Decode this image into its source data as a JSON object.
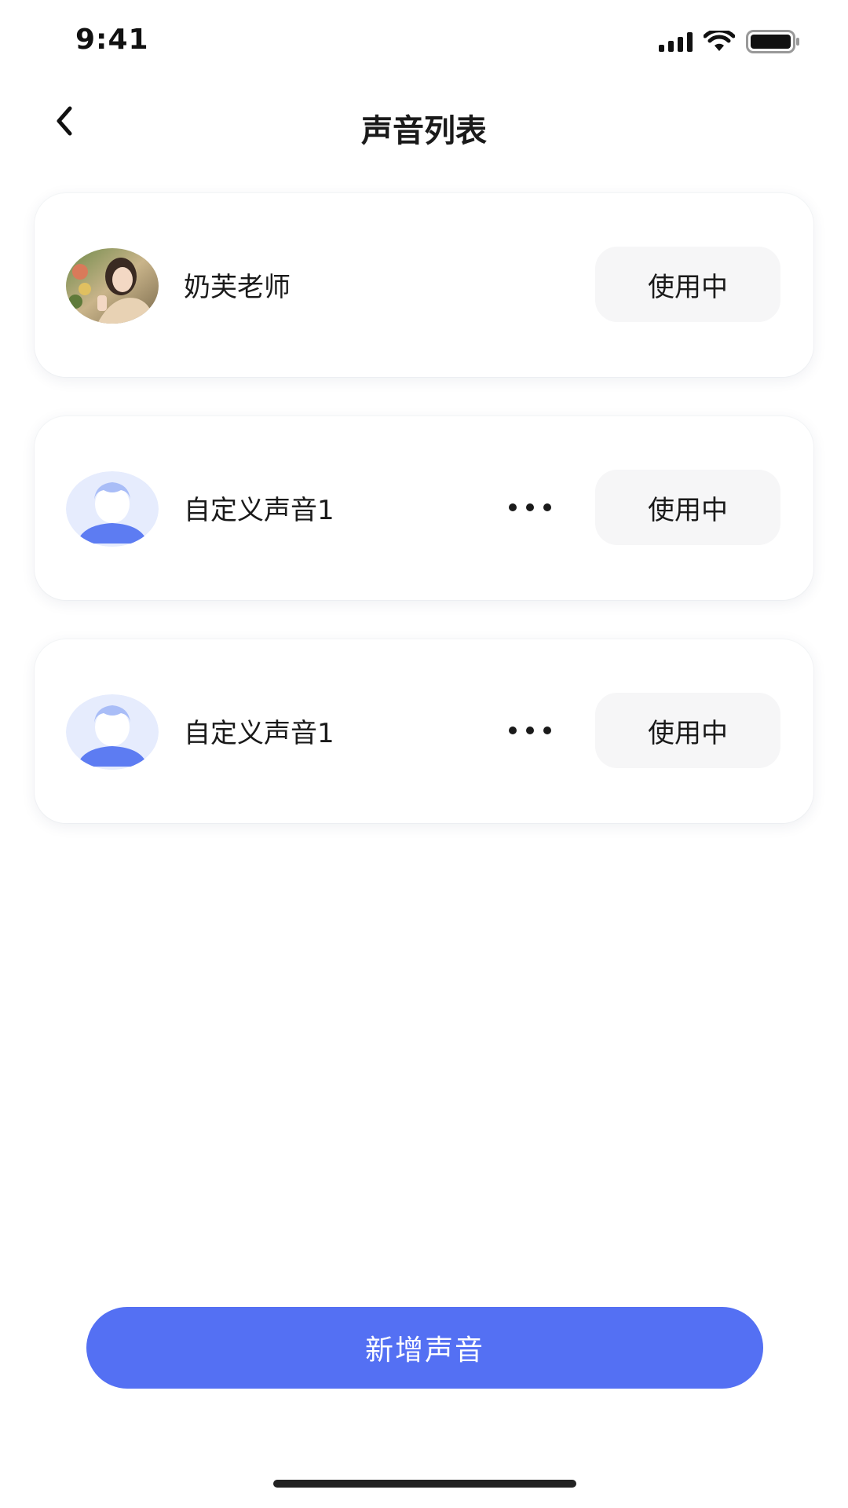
{
  "status_bar": {
    "time": "9:41",
    "icons": [
      "signal-icon",
      "wifi-icon",
      "battery-icon"
    ]
  },
  "header": {
    "back_icon": "chevron-left-icon",
    "title": "声音列表"
  },
  "voices": [
    {
      "name": "奶芙老师",
      "avatar": "photo-avatar",
      "has_more": false,
      "status_label": "使用中"
    },
    {
      "name": "自定义声音1",
      "avatar": "default-user-avatar",
      "has_more": true,
      "more_icon": "more-dots-icon",
      "status_label": "使用中"
    },
    {
      "name": "自定义声音1",
      "avatar": "default-user-avatar",
      "has_more": true,
      "more_icon": "more-dots-icon",
      "status_label": "使用中"
    }
  ],
  "add_button": {
    "label": "新增声音"
  },
  "colors": {
    "accent": "#5470f3",
    "status_button_bg": "#f6f6f7",
    "avatar_bg": "#e6ecfd",
    "avatar_body": "#5d7cf2",
    "avatar_hair": "#a9bdf7"
  }
}
